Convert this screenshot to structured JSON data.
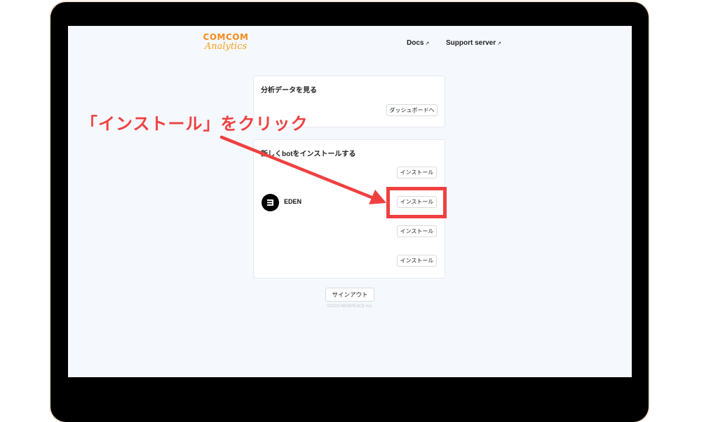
{
  "header": {
    "logo_line1": "COMCOM",
    "logo_line2": "Analytics",
    "nav_docs": "Docs",
    "nav_support": "Support server",
    "external_glyph": "↗"
  },
  "analytics_card": {
    "title": "分析データを見る",
    "dashboard_button": "ダッシュボードへ"
  },
  "install_card": {
    "title": "新しくbotをインストールする",
    "bots": [
      {
        "name": "",
        "button": "インストール"
      },
      {
        "name": "EDEN",
        "button": "インストール"
      },
      {
        "name": "",
        "button": "インストール"
      },
      {
        "name": "",
        "button": "インストール"
      }
    ]
  },
  "signout_button": "サインアウト",
  "footer_text": "©2023 NEWPEACE Inc.",
  "annotation": {
    "text": "「インストール」をクリック",
    "color": "#ef4040"
  },
  "colors": {
    "accent": "#ef4040",
    "logo_orange": "#f28a1e",
    "screen_bg": "#f5f8fc"
  }
}
